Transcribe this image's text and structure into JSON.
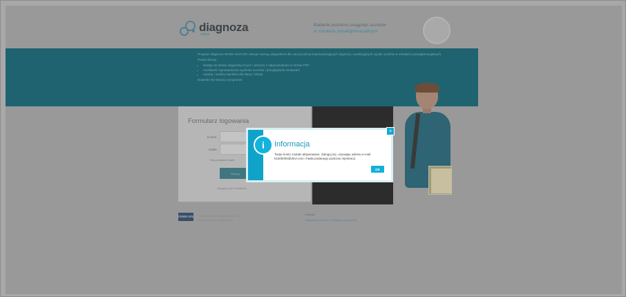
{
  "header": {
    "logo_text": "diagnoza",
    "logo_sub": "online",
    "tagline_line1": "Badanie poziomu osiągnięć uczniów",
    "tagline_line2": "w szkołach ponadgimnazjalnych"
  },
  "band": {
    "intro": "Program diagnoza NOWA MATURA oferuje szereg udogodnień dla nauczycieli przeprowadzających diagnozy i analizujących wyniki uczniów w szkołach ponadgimnazjalnych.",
    "offers_title": "Portal oferuje:",
    "offers": [
      "dostęp do testów diagnostycznych i arkuszy z odpowiedziami w formie PDF",
      "możliwość wprowadzania wyników uczniów i przeglądania zestawień",
      "raporty i analizy wyników dla klasy i szkoły"
    ],
    "more": "Dowiedz się więcej o programie"
  },
  "login": {
    "title": "Formularz logowania",
    "email_label": "E-mail",
    "password_label": "Hasło",
    "helper": "Nie pamiętam hasła",
    "button": "Zaloguj",
    "facebook": "Zaloguj przez Facebook"
  },
  "footer": {
    "logo": "nowa era",
    "left_line1": "© Wydawnictwo Nowa Era Sp. z o.o.",
    "left_line2": "Wszelkie prawa zastrzeżone",
    "right_title": "Kontakt",
    "right_links": "Regulamin | Pomoc | Polityka prywatności"
  },
  "modal": {
    "icon": "i",
    "title": "Informacja",
    "message": "Twoje konto zostało aktywowane. Zaloguj się, używając adresu e-mail k1600005@drivr.com i hasła podanego podczas rejestracji.",
    "ok": "OK",
    "close": "×"
  }
}
